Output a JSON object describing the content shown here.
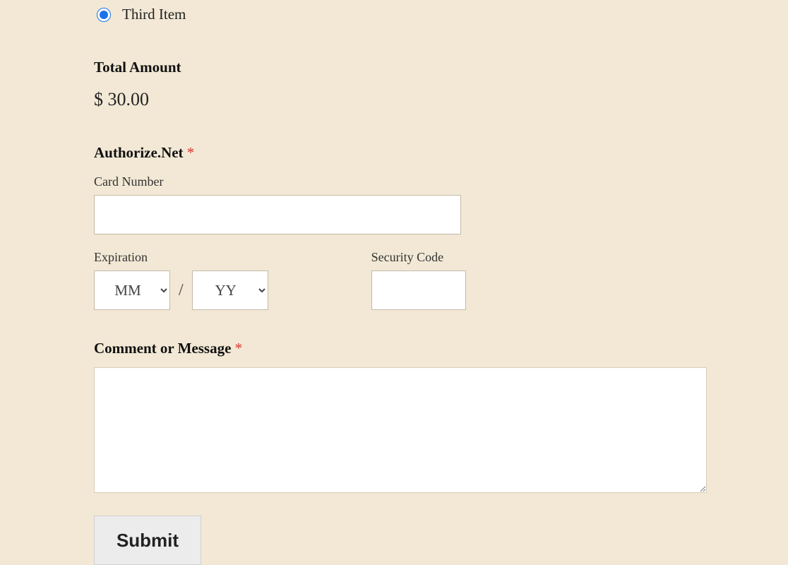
{
  "radio": {
    "third_item_label": "Third Item"
  },
  "total": {
    "heading": "Total Amount",
    "value": "$ 30.00"
  },
  "payment": {
    "heading": "Authorize.Net ",
    "card_number_label": "Card Number",
    "expiration_label": "Expiration",
    "expiration_month_placeholder": "MM",
    "expiration_year_placeholder": "YY",
    "expiration_separator": "/",
    "security_code_label": "Security Code"
  },
  "comment": {
    "heading": "Comment or Message "
  },
  "submit_label": "Submit",
  "required_marker": "*"
}
